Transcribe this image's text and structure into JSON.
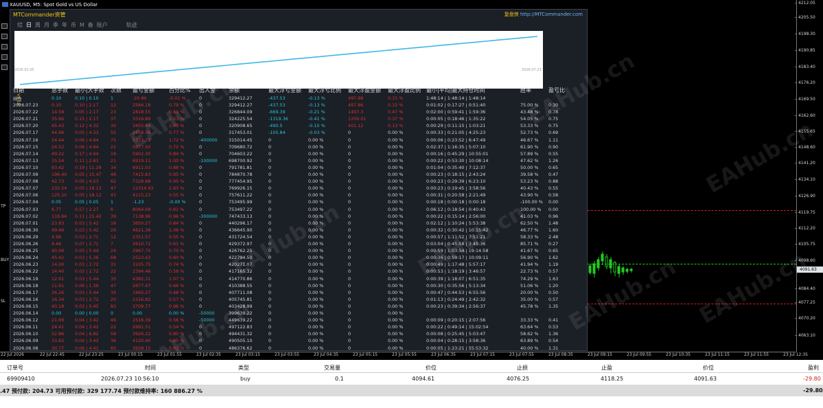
{
  "window_title": "XAUUSD, M5:  Spot Gold vs US Dollar",
  "header": {
    "brand": "MTCommander资管",
    "promo_prefix": "复盘侠",
    "promo_url": "http://MTCommander.com"
  },
  "tabs": [
    {
      "label": "综",
      "active": false
    },
    {
      "label": "日",
      "active": true
    },
    {
      "label": "周",
      "active": false
    },
    {
      "label": "月",
      "active": false
    },
    {
      "label": "季",
      "active": false
    },
    {
      "label": "年",
      "active": false
    },
    {
      "label": "币",
      "active": false
    },
    {
      "label": "M",
      "active": false
    },
    {
      "label": "备",
      "active": false
    },
    {
      "label": "账户",
      "active": false
    },
    {
      "label": "轨迹",
      "active": false
    }
  ],
  "equity": {
    "start_label": "2026.01.05",
    "end_label": "2026.07.23",
    "series": [
      0.0,
      0.02,
      0.04,
      0.06,
      0.08,
      0.1,
      0.12,
      0.14,
      0.16,
      0.18,
      0.2,
      0.22,
      0.24,
      0.26,
      0.28,
      0.3,
      0.32,
      0.34,
      0.36,
      0.38,
      0.4,
      0.42,
      0.44,
      0.46,
      0.48,
      0.5,
      0.52,
      0.54,
      0.56,
      0.58,
      0.6,
      0.62,
      0.64,
      0.66,
      0.68,
      0.7,
      0.72,
      0.74,
      0.76,
      0.78,
      0.8,
      0.82,
      0.84,
      0.86,
      0.88,
      0.9,
      0.92,
      0.94,
      0.96,
      0.98,
      1.0
    ]
  },
  "side_vertical_label": "V8.18",
  "table": {
    "columns": [
      "日期",
      "总手数",
      "最小|大手数",
      "次数",
      "盈亏金额",
      "百分比%",
      "出入金",
      "余额",
      "最大浮亏金额",
      "最大浮亏比例",
      "最大浮盈金额",
      "最大浮盈比例",
      "最小|平均|最大持仓时间",
      "胜率",
      "盈亏比"
    ],
    "hold_row": [
      "持仓",
      "0.10",
      "0.10 | 0.10",
      "1",
      "-20.80",
      "-0.01 %",
      "0",
      "329412.27",
      "-437.53",
      "-0.13 %",
      "497.86",
      "0.15 %",
      "1:48:14 | 1:48:14 | 1:48:14",
      "",
      ""
    ],
    "rows": [
      [
        "2026.07.23",
        "0.10",
        "0.10 | 2.17",
        "12",
        "2566.18",
        "0.79 %",
        "0",
        "329412.27",
        "-437.53",
        "-0.13 %",
        "497.86",
        "0.15 %",
        "0:01:02 | 0:17:27 | 0:51:40",
        "75.00 %",
        "0.30"
      ],
      [
        "2026.07.22",
        "14.58",
        "0.05 | 2.17",
        "23",
        "2818.55",
        "0.81 %",
        "0",
        "326844.09",
        "-669.39",
        "-0.21 %",
        "1497.3",
        "0.47 %",
        "0:02:00 | 0:59:41 | 1:59:36",
        "43.48 %",
        "0.78"
      ],
      [
        "2026.07.21",
        "35.66",
        "0.15 | 2.17",
        "37",
        "3316.89",
        "1.03 %",
        "0",
        "324225.54",
        "-1319.36",
        "-0.41 %",
        "1200.01",
        "0.37 %",
        "0:00:05 | 0:18:46 | 1:35:22",
        "54.05 %",
        "0.75"
      ],
      [
        "2026.07.20",
        "65.43",
        "0.12 | 4.32",
        "30",
        "3455.64",
        "1.09 %",
        "0",
        "320908.65",
        "-490.5",
        "-0.15 %",
        "401.12",
        "0.13 %",
        "0:00:29 | 0:11:15 | 1:03:21",
        "53.33 %",
        "0.75"
      ],
      [
        "2026.07.17",
        "44.96",
        "0.05 | 4.33",
        "55",
        "2458.56",
        "0.77 %",
        "0",
        "317453.01",
        "-105.84",
        "-0.03 %",
        "0",
        "0.00 %",
        "0:00:33 | 0:21:05 | 4:25:23",
        "52.73 %",
        "0.69"
      ],
      [
        "2026.07.16",
        "54.44",
        "0.06 | 4.94",
        "75",
        "5323.73",
        "1.72 %",
        "-400000",
        "315014.45",
        "0",
        "0.00 %",
        "0",
        "0.00 %",
        "0:00:06 | 0:23:52 | 6:47:49",
        "46.67 %",
        "1.11"
      ],
      [
        "2026.07.15",
        "24.52",
        "0.06 | 4.94",
        "21",
        "5077.50",
        "0.72 %",
        "0",
        "709680.72",
        "0",
        "0.00 %",
        "0",
        "0.00 %",
        "0:02:37 | 1:16:35 | 5:07:10",
        "61.90 %",
        "0.90"
      ],
      [
        "2026.07.14",
        "49.22",
        "0.17 | 4.94",
        "19",
        "5902.30",
        "0.84 %",
        "0",
        "704603.22",
        "0",
        "0.00 %",
        "0",
        "0.00 %",
        "0:00:16 | 0:45:29 | 10:55:01",
        "57.89 %",
        "0.55"
      ],
      [
        "2026.07.13",
        "15.54",
        "0.11 | 2.83",
        "21",
        "6919.11",
        "1.00 %",
        "-100000",
        "698700.92",
        "0",
        "0.00 %",
        "0",
        "0.00 %",
        "0:00:22 | 0:53:30 | 10:08:14",
        "47.62 %",
        "1.26"
      ],
      [
        "2026.07.10",
        "93.42",
        "0.19 | 11.29",
        "34",
        "6911.03",
        "0.88 %",
        "0",
        "791781.81",
        "0",
        "0.00 %",
        "0",
        "0.00 %",
        "0:01:04 | 0:35:40 | 7:12:37",
        "50.00 %",
        "0.65"
      ],
      [
        "2026.07.09",
        "196.40",
        "0.05 | 15.47",
        "48",
        "7415.83",
        "0.95 %",
        "0",
        "784870.78",
        "0",
        "0.00 %",
        "0",
        "0.00 %",
        "0:00:23 | 0:18:15 | 2:43:24",
        "39.58 %",
        "0.47"
      ],
      [
        "2026.07.08",
        "42.73",
        "0.05 | 4.53",
        "62",
        "7328.88",
        "0.95 %",
        "0",
        "777454.95",
        "0",
        "0.00 %",
        "0",
        "0.00 %",
        "0:00:23 | 0:29:39 | 6:23:10",
        "53.23 %",
        "0.88"
      ],
      [
        "2026.07.07",
        "232.54",
        "0.05 | 18.13",
        "47",
        "12314.93",
        "1.63 %",
        "0",
        "769926.15",
        "0",
        "0.00 %",
        "0",
        "0.00 %",
        "0:00:23 | 0:19:45 | 3:58:56",
        "40.43 %",
        "0.55"
      ],
      [
        "2026.07.06",
        "125.10",
        "0.05 | 18.12",
        "41",
        "4115.23",
        "0.55 %",
        "0",
        "757611.22",
        "0",
        "0.00 %",
        "0",
        "0.00 %",
        "0:00:31 | 0:20:58 | 2:21:49",
        "43.90 %",
        "0.58"
      ],
      [
        "2026.07.04",
        "0.05",
        "0.05 | 0.05",
        "1",
        "-1.23",
        "-0.00 %",
        "0",
        "753495.99",
        "0",
        "0.00 %",
        "0",
        "0.00 %",
        "0:00:18 | 0:00:18 | 0:00:18",
        "-100.00 %",
        "0.00"
      ],
      [
        "2026.07.03",
        "6.77",
        "0.57 | 2.27",
        "6",
        "8064.09",
        "0.81 %",
        "0",
        "753497.22",
        "0",
        "0.00 %",
        "0",
        "0.00 %",
        "0:06:12 | 0:18:54 | 0:40:43",
        "100.00 %",
        "0.00"
      ],
      [
        "2026.07.02",
        "116.64",
        "0.11 | 15.42",
        "39",
        "7138.96",
        "0.96 %",
        "-300000",
        "747433.13",
        "0",
        "0.00 %",
        "0",
        "0.00 %",
        "0:00:22 | 0:15:14 | 2:56:00",
        "41.03 %",
        "0.96"
      ],
      [
        "2026.07.01",
        "23.83",
        "0.03 | 5.42",
        "16",
        "3650.27",
        "0.84 %",
        "0",
        "440296.17",
        "0",
        "0.00 %",
        "0",
        "0.00 %",
        "0:02:12 | 1:10:24 | 5:53:38",
        "62.50 %",
        "1.48"
      ],
      [
        "2026.06.30",
        "49.46",
        "0.03 | 5.42",
        "26",
        "4621.38",
        "1.06 %",
        "0",
        "436645.90",
        "0",
        "0.00 %",
        "0",
        "0.00 %",
        "0:00:32 | 0:30:42 | 10:15:42",
        "46.77 %",
        "1.60"
      ],
      [
        "2026.06.29",
        "4.96",
        "0.03 | 2.71",
        "12",
        "2351.57",
        "0.55 %",
        "0",
        "431724.54",
        "0",
        "0.00 %",
        "0",
        "0.00 %",
        "0:00:57 | 1:11:52 | 7:51:21",
        "58.33 %",
        "2.48"
      ],
      [
        "2026.06.26",
        "6.46",
        "0.07 | 2.71",
        "7",
        "2610.72",
        "0.61 %",
        "0",
        "429372.97",
        "0",
        "0.00 %",
        "0",
        "0.00 %",
        "0:03:04 | 0:45:58 | 3:45:36",
        "85.71 %",
        "0.27"
      ],
      [
        "2026.06.25",
        "40.06",
        "0.03 | 5.44",
        "24",
        "2967.75",
        "0.70 %",
        "0",
        "426762.25",
        "0",
        "0.00 %",
        "0",
        "0.00 %",
        "0:00:59 | 1:03:54 | 19:14:58",
        "41.67 %",
        "0.65"
      ],
      [
        "2026.06.24",
        "45.42",
        "0.03 | 5.36",
        "68",
        "2523.43",
        "0.60 %",
        "0",
        "422794.50",
        "0",
        "0.00 %",
        "0",
        "0.00 %",
        "0:00:36 | 0:59:17 | 10:09:11",
        "56.90 %",
        "1.62"
      ],
      [
        "2026.06.23",
        "14.00",
        "0.03 | 2.72",
        "31",
        "3105.75",
        "0.74 %",
        "0",
        "420271.07",
        "0",
        "0.00 %",
        "0",
        "0.00 %",
        "0:00:49 | 1:17:48 | 5:57:17",
        "41.94 %",
        "1.19"
      ],
      [
        "2026.06.22",
        "14.40",
        "0.03 | 2.72",
        "22",
        "2394.46",
        "0.58 %",
        "0",
        "417165.32",
        "0",
        "0.00 %",
        "0",
        "0.00 %",
        "0:00:53 | 1:18:19 | 3:46:57",
        "22.73 %",
        "0.57"
      ],
      [
        "2026.06.19",
        "12.91",
        "0.03 | 5.44",
        "35",
        "4382.31",
        "1.07 %",
        "0",
        "414770.86",
        "0",
        "0.00 %",
        "0",
        "0.00 %",
        "0:00:39 | 1:18:07 | 6:51:35",
        "74.29 %",
        "1.63"
      ],
      [
        "2026.06.18",
        "11.61",
        "0.06 | 1.36",
        "47",
        "2677.47",
        "0.66 %",
        "0",
        "410388.55",
        "0",
        "0.00 %",
        "0",
        "0.00 %",
        "0:00:30 | 0:35:56 | 5:13:34",
        "51.06 %",
        "1.20"
      ],
      [
        "2026.06.17",
        "26.26",
        "0.03 | 5.44",
        "35",
        "1965.27",
        "0.48 %",
        "0",
        "407711.08",
        "0",
        "0.00 %",
        "0",
        "0.00 %",
        "0:00:47 | 0:44:53 | 6:55:56",
        "20.00 %",
        "0.50"
      ],
      [
        "2026.06.16",
        "16.34",
        "0.03 | 2.72",
        "20",
        "2316.82",
        "0.57 %",
        "0",
        "405745.81",
        "0",
        "0.00 %",
        "0",
        "0.00 %",
        "0:01:13 | 0:24:49 | 2:42:32",
        "35.00 %",
        "0.57"
      ],
      [
        "2026.06.15",
        "40.18",
        "0.03 | 5.45",
        "83",
        "3709.77",
        "0.96 %",
        "0",
        "403428.99",
        "0",
        "0.00 %",
        "0",
        "0.00 %",
        "0:00:23 | 0:39:34 | 2:56:37",
        "45.78 %",
        "1.35"
      ],
      [
        "2026.06.14",
        "0.00",
        "0.00 | 0.00",
        "0",
        "0.00",
        "0.00 %",
        "-50000",
        "399639.22",
        "0",
        "0.00 %",
        "0",
        "0.00 %",
        "",
        "",
        ""
      ],
      [
        "2026.06.12",
        "21.99",
        "0.04 | 3.42",
        "46",
        "2516.39",
        "0.56 %",
        "-50000",
        "449639.22",
        "0",
        "0.00 %",
        "0",
        "0.00 %",
        "0:00:09 | 0:20:15 | 2:07:56",
        "33.33 %",
        "0.41"
      ],
      [
        "2026.06.11",
        "24.41",
        "0.04 | 3.42",
        "22",
        "2691.51",
        "0.54 %",
        "0",
        "497122.83",
        "0",
        "0.00 %",
        "0",
        "0.00 %",
        "0:00:22 | 0:49:14 | 15:02:54",
        "63.64 %",
        "0.53"
      ],
      [
        "2026.06.10",
        "52.86",
        "0.04 | 6.82",
        "58",
        "3926.22",
        "0.80 %",
        "0",
        "494431.32",
        "0",
        "0.00 %",
        "0",
        "0.00 %",
        "0:00:08 | 0:25:45 | 5:03:47",
        "58.62 %",
        "1.36"
      ],
      [
        "2026.06.09",
        "33.62",
        "0.04 | 3.42",
        "36",
        "4120.40",
        "0.85 %",
        "0",
        "490505.10",
        "0",
        "0.00 %",
        "0",
        "0.00 %",
        "0:00:04 | 0:28:15 | 3:58:36",
        "63.89 %",
        "0.54"
      ],
      [
        "2026.06.08",
        "30.77",
        "0.06 | 4.41",
        "60",
        "3928.15",
        "0.82 %",
        "0",
        "486376.62",
        "0",
        "0.00 %",
        "0",
        "0.00 %",
        "0:00:05 | 1:23:21 | 55:53:32",
        "40.00 %",
        "1.31"
      ]
    ]
  },
  "price_scale": [
    {
      "v": "4212.05",
      "top": 4
    },
    {
      "v": "4205.50",
      "top": 25
    },
    {
      "v": "4198.30",
      "top": 49
    },
    {
      "v": "4190.85",
      "top": 73
    },
    {
      "v": "4183.40",
      "top": 97
    },
    {
      "v": "4176.20",
      "top": 120
    },
    {
      "v": "4169.50",
      "top": 144
    },
    {
      "v": "4162.60",
      "top": 168
    },
    {
      "v": "4155.65",
      "top": 191
    },
    {
      "v": "4148.60",
      "top": 214
    },
    {
      "v": "4141.20",
      "top": 237
    },
    {
      "v": "4134.10",
      "top": 261
    },
    {
      "v": "4126.90",
      "top": 285
    },
    {
      "v": "4119.75",
      "top": 309
    },
    {
      "v": "4112.20",
      "top": 332
    },
    {
      "v": "4105.75",
      "top": 355
    },
    {
      "v": "4098.60",
      "top": 379
    },
    {
      "v": "4091.63",
      "top": 394
    },
    {
      "v": "4084.40",
      "top": 420
    },
    {
      "v": "4077.25",
      "top": 440
    },
    {
      "v": "4070.20",
      "top": 463
    },
    {
      "v": "4063.10",
      "top": 488
    }
  ],
  "chart_markers": {
    "tp": "TP",
    "buy": "BUY",
    "sl": "SL"
  },
  "time_scale": [
    "22 Jul 2026",
    "22 Jul 22:45",
    "22 Jul 23:25",
    "23 Jul 00:15",
    "23 Jul 01:55",
    "23 Jul 02:35",
    "23 Jul 03:15",
    "23 Jul 03:55",
    "23 Jul 04:35",
    "23 Jul 05:15",
    "23 Jul 05:55",
    "23 Jul 06:35",
    "23 Jul 07:15",
    "23 Jul 07:55",
    "23 Jul 08:35",
    "23 Jul 09:15",
    "23 Jul 09:55",
    "23 Jul 10:35",
    "23 Jul 11:15",
    "23 Jul 11:55",
    "23 Jul 12:35"
  ],
  "trade": {
    "headers": {
      "ticket": "订单号",
      "time": "时间",
      "type": "类型",
      "volume": "交易量",
      "price": "价位",
      "sl": "止损",
      "tp": "止盈",
      "cur_price": "价位",
      "profit": "盈利"
    },
    "row": {
      "ticket": "69909410",
      "time": "2026.07.23 10:56:10",
      "type": "buy",
      "volume": "0.1",
      "price": "4094.61",
      "sl": "4076.25",
      "tp": "4118.25",
      "cur_price": "4091.63",
      "profit": "-29.80"
    },
    "summary": {
      "text": ".47  预付款: 204.73  可用预付款: 329 177.74  预付款维持率: 160 886.27 %",
      "profit": "-29.80"
    }
  },
  "watermarks": [
    "EAHub.cn",
    "EAHub.cn",
    "EAHub.cn",
    "EAHub.cn",
    "EAHub.cn",
    "EAHub.cn",
    "EAHub.cn",
    "EAHub.cn",
    "cn",
    "cn",
    "cn",
    "cn"
  ],
  "colors": {
    "panel_bg": "#1b1f26",
    "brand": "#f5c518",
    "accent": "#28c8dc",
    "loss": "#e03030",
    "equity_line": "#3fb6e8"
  }
}
